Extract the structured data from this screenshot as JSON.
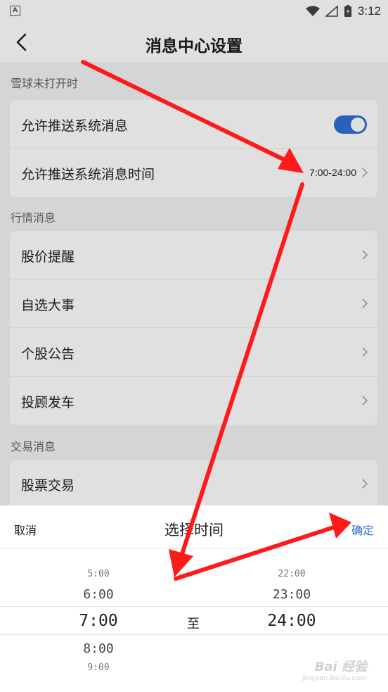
{
  "status_bar": {
    "time": "3:12",
    "app_icon_letter": "A"
  },
  "header": {
    "title": "消息中心设置"
  },
  "sections": [
    {
      "title": "雪球未打开时"
    },
    {
      "title": "行情消息"
    },
    {
      "title": "交易消息"
    }
  ],
  "unopened": {
    "allow_push_label": "允许推送系统消息",
    "allow_push_enabled": true,
    "push_time_label": "允许推送系统消息时间",
    "push_time_value": "7:00-24:00"
  },
  "market": {
    "items": [
      {
        "label": "股价提醒"
      },
      {
        "label": "自选大事"
      },
      {
        "label": "个股公告"
      },
      {
        "label": "投顾发车"
      }
    ]
  },
  "trade": {
    "items": [
      {
        "label": "股票交易"
      }
    ]
  },
  "picker": {
    "cancel_label": "取消",
    "title": "选择时间",
    "confirm_label": "确定",
    "to_label": "至",
    "start_options": [
      "5:00",
      "6:00",
      "7:00",
      "8:00",
      "9:00"
    ],
    "end_options": [
      "22:00",
      "23:00",
      "24:00"
    ]
  },
  "watermark": {
    "brand": "Bai 经验",
    "url": "jingyan.baidu.com"
  },
  "colors": {
    "accent": "#2f6fd6",
    "arrow": "#ff1a1a"
  }
}
